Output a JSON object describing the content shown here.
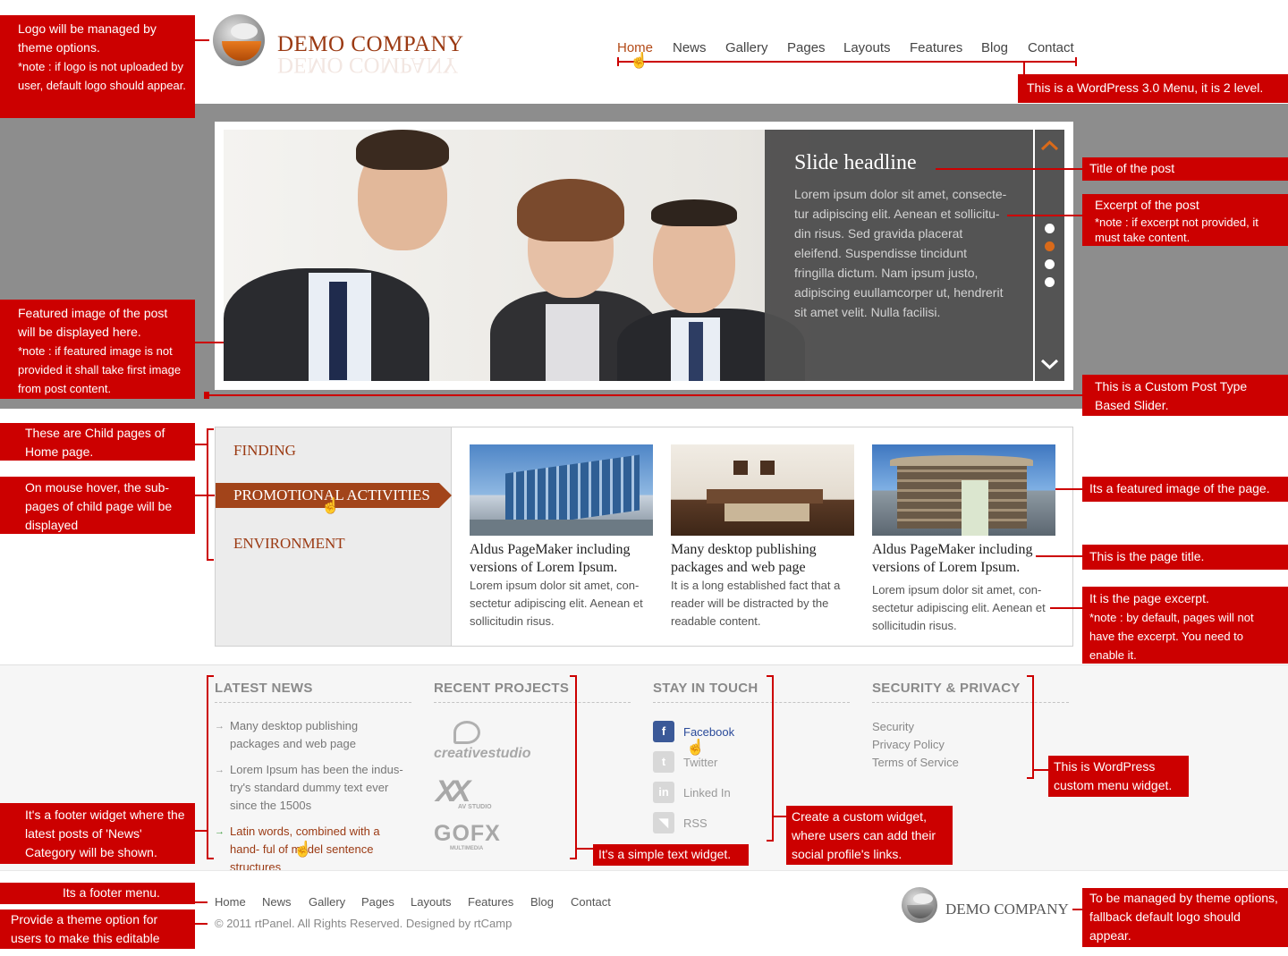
{
  "header": {
    "logo_text": "DEMO COMPANY",
    "nav": [
      "Home",
      "News",
      "Gallery",
      "Pages",
      "Layouts",
      "Features",
      "Blog",
      "Contact"
    ],
    "active_index": 0
  },
  "slider": {
    "headline": "Slide headline",
    "excerpt": "Lorem ipsum dolor sit amet, consecte- tur adipiscing elit. Aenean et sollicitu- din risus. Sed gravida placerat eleifend. Suspendisse tincidunt fringilla dictum. Nam ipsum justo, adipiscing euullamcorper ut, hendrerit sit amet velit. Nulla facilisi.",
    "dots": 4,
    "active_dot": 1,
    "up_icon": "chevron-up-icon",
    "down_icon": "chevron-down-icon"
  },
  "child_pages": {
    "items": [
      "FINDING",
      "PROMOTIONAL ACTIVITIES",
      "ENVIRONMENT"
    ],
    "active_index": 1
  },
  "cards": [
    {
      "title": "Aldus PageMaker including versions of Lorem Ipsum.",
      "excerpt": "Lorem ipsum dolor sit amet, con- sectetur adipiscing elit. Aenean et sollicitudin risus."
    },
    {
      "title": "Many desktop publishing packages and web page",
      "excerpt": "It is a long established fact that a reader will be distracted by the readable content."
    },
    {
      "title": "Aldus PageMaker including versions of Lorem Ipsum.",
      "excerpt": "Lorem ipsum dolor sit amet, con- sectetur adipiscing elit. Aenean et sollicitudin risus."
    }
  ],
  "footer_widgets": {
    "latest_news": {
      "title": "LATEST NEWS",
      "items": [
        "Many desktop publishing packages and web page",
        "Lorem Ipsum has been the indus- try's standard dummy text ever since the 1500s",
        "Latin words, combined with a hand- ful of model sentence structures"
      ]
    },
    "recent_projects": {
      "title": "RECENT PROJECTS",
      "logos": [
        "creativestudio",
        "AV STUDIO",
        "GOFX",
        "MULTIMEDIA"
      ]
    },
    "stay_in_touch": {
      "title": "STAY IN TOUCH",
      "links": [
        "Facebook",
        "Twitter",
        "Linked In",
        "RSS"
      ]
    },
    "security": {
      "title": "SECURITY & PRIVACY",
      "links": [
        "Security",
        "Privacy Policy",
        "Terms of Service"
      ]
    }
  },
  "footer": {
    "menu": [
      "Home",
      "News",
      "Gallery",
      "Pages",
      "Layouts",
      "Features",
      "Blog",
      "Contact"
    ],
    "copyright": "© 2011 rtPanel. All Rights Reserved. Designed by rtCamp",
    "logo_text": "DEMO COMPANY"
  },
  "callouts": {
    "logo": "Logo will be managed by theme options.",
    "logo_note": "*note : if logo is not uploaded by user, default logo should appear.",
    "menu": "This is a WordPress 3.0 Menu, it is 2 level.",
    "post_title": "Title of the post",
    "excerpt": "Excerpt of the post",
    "excerpt_note": "*note : if excerpt not provided, it must take content.",
    "featured": "Featured image of the post will be displayed here.",
    "featured_note": "*note : if featured image is not provided it shall take first image from post content.",
    "slider": "This is a Custom Post Type Based Slider.",
    "child_pages": "These are Child pages of Home page.",
    "hover": "On mouse hover, the sub-pages of child page will be displayed",
    "page_image": "Its a featured image of the page.",
    "page_title": "This is the page title.",
    "page_excerpt": "It is the page excerpt.",
    "page_excerpt_note": "*note : by default, pages will not have the excerpt. You need to enable it.",
    "latest_widget": "It's a footer widget where the latest posts of 'News' Category will be shown.",
    "text_widget": "It's a simple text widget.",
    "social_widget": "Create a custom widget, where users can add their social profile's links.",
    "menu_widget": "This is WordPress custom menu widget.",
    "footer_menu": "Its a footer menu.",
    "copyright_opt": "Provide a theme option for users to make this editable",
    "footer_logo": "To be managed by theme options, fallback default logo should appear."
  }
}
